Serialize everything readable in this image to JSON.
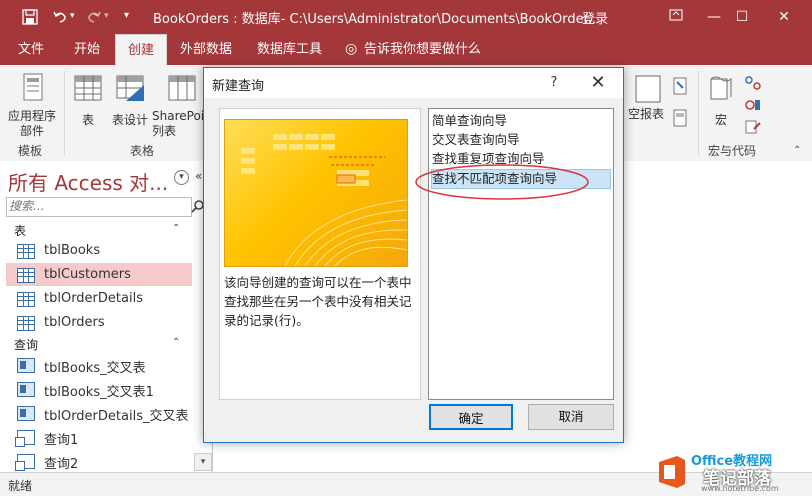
{
  "window": {
    "title": "BookOrders : 数据库- C:\\Users\\Administrator\\Documents\\BookOrder...",
    "login": "登录",
    "accent": "#a4373a"
  },
  "tabs": [
    {
      "label": "文件"
    },
    {
      "label": "开始"
    },
    {
      "label": "创建",
      "active": true
    },
    {
      "label": "外部数据"
    },
    {
      "label": "数据库工具"
    }
  ],
  "tell_me": "告诉我你想要做什么",
  "ribbon": {
    "app_parts": "应用程序\n部件",
    "table": "表",
    "table_design": "表设计",
    "sharepoint": "SharePoi\n列表",
    "report_blank": "空报表",
    "macro": "宏",
    "group_templates": "模板",
    "group_tables": "表格",
    "group_macros": "宏与代码"
  },
  "nav": {
    "title": "所有 Access 对...",
    "search_placeholder": "搜索...",
    "sections": [
      {
        "label": "表",
        "items": [
          "tblBooks",
          "tblCustomers",
          "tblOrderDetails",
          "tblOrders"
        ]
      },
      {
        "label": "查询",
        "items": [
          "tblBooks_交叉表",
          "tblBooks_交叉表1",
          "tblOrderDetails_交叉表",
          "查询1",
          "查询2"
        ]
      }
    ],
    "selected": "tblCustomers"
  },
  "dialog": {
    "title": "新建查询",
    "help": "?",
    "description": "该向导创建的查询可以在一个表中查找那些在另一个表中没有相关记录的记录(行)。",
    "options": [
      "简单查询向导",
      "交叉表查询向导",
      "查找重复项查询向导",
      "查找不匹配项查询向导"
    ],
    "selected_option": "查找不匹配项查询向导",
    "ok": "确定",
    "cancel": "取消"
  },
  "status": "就绪",
  "watermark": {
    "line1": "Office教程网",
    "line2": "笔记部落",
    "line3": "www.notetribe.com"
  }
}
